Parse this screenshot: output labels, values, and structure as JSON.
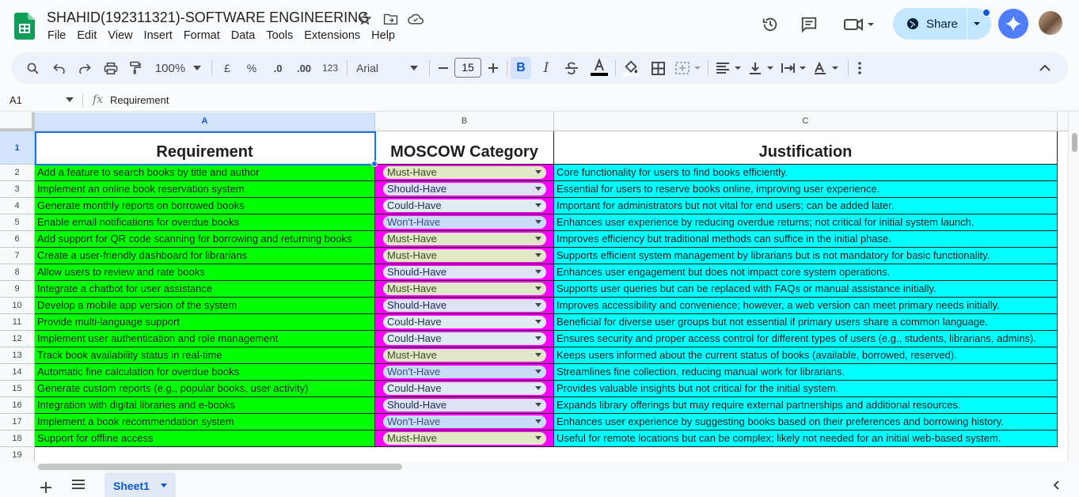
{
  "app": {
    "title": "SHAHID(192311321)-SOFTWARE ENGINEERING",
    "menu": [
      "File",
      "Edit",
      "View",
      "Insert",
      "Format",
      "Data",
      "Tools",
      "Extensions",
      "Help"
    ],
    "share_label": "Share"
  },
  "toolbar": {
    "zoom": "100%",
    "currency": "£",
    "percent": "%",
    "dec_decrease": ".0",
    "dec_increase": ".00",
    "number_format": "123",
    "font": "Arial",
    "font_size": "15"
  },
  "formula_bar": {
    "name_box": "A1",
    "fx": "fx",
    "content": "Requirement"
  },
  "columns": [
    "A",
    "B",
    "C"
  ],
  "row_numbers": [
    "1",
    "2",
    "3",
    "4",
    "5",
    "6",
    "7",
    "8",
    "9",
    "10",
    "11",
    "12",
    "13",
    "14",
    "15",
    "16",
    "17",
    "18",
    "19"
  ],
  "headers": {
    "a": "Requirement",
    "b": "MOSCOW Category",
    "c": "Justification"
  },
  "rows": [
    {
      "req": "Add a feature to search books by title and author",
      "cat": "Must-Have",
      "just": "Core functionality for users to find books efficiently."
    },
    {
      "req": "Implement an online book reservation system",
      "cat": "Should-Have",
      "just": "Essential for users to reserve books online, improving user experience."
    },
    {
      "req": "Generate monthly reports on borrowed books",
      "cat": "Could-Have",
      "just": "Important for administrators but not vital for end users; can be added later."
    },
    {
      "req": "Enable email notifications for overdue books",
      "cat": "Won't-Have",
      "just": "Enhances user experience by reducing overdue returns; not critical for initial system launch."
    },
    {
      "req": "Add support for QR code scanning for borrowing and returning books",
      "cat": "Must-Have",
      "just": "Improves efficiency but traditional methods can suffice in the initial phase."
    },
    {
      "req": "Create a user-friendly dashboard for librarians",
      "cat": "Must-Have",
      "just": "Supports efficient system management by librarians but is not mandatory for basic functionality."
    },
    {
      "req": "Allow users to review and rate books",
      "cat": "Should-Have",
      "just": "Enhances user engagement but does not impact core system operations."
    },
    {
      "req": "Integrate a chatbot for user assistance",
      "cat": "Must-Have",
      "just": "Supports user queries but can be replaced with FAQs or manual assistance initially."
    },
    {
      "req": "Develop a mobile app version of the system",
      "cat": "Should-Have",
      "just": "Improves accessibility and convenience; however, a web version can meet primary needs initially."
    },
    {
      "req": "Provide multi-language support",
      "cat": "Could-Have",
      "just": "Beneficial for diverse user groups but not essential if primary users share a common language."
    },
    {
      "req": "Implement user authentication and role management",
      "cat": "Could-Have",
      "just": "Ensures security and proper access control for different types of users (e.g., students, librarians, admins)."
    },
    {
      "req": "Track book availability status in real-time",
      "cat": "Must-Have",
      "just": "Keeps users informed about the current status of books (available, borrowed, reserved)."
    },
    {
      "req": "Automatic fine calculation for overdue books",
      "cat": "Won't-Have",
      "just": "Streamlines fine collection, reducing manual work for librarians."
    },
    {
      "req": "Generate custom reports (e.g., popular books, user activity)",
      "cat": "Could-Have",
      "just": "Provides valuable insights but not critical for the initial system."
    },
    {
      "req": "Integration with digital libraries and e-books",
      "cat": "Should-Have",
      "just": "Expands library offerings but may require external partnerships and additional resources."
    },
    {
      "req": "Implement a book recommendation system",
      "cat": "Won't-Have",
      "just": "Enhances user experience by suggesting books based on their preferences and borrowing history."
    },
    {
      "req": "Support for offline access",
      "cat": "Must-Have",
      "just": "Useful for remote locations but can be complex; likely not needed for an initial web-based system."
    }
  ],
  "chip_colors": {
    "Must-Have": "#e0e8c8",
    "Should-Have": "#dde3f5",
    "Could-Have": "#e0eaf2",
    "Won't-Have": "#c9dcf7"
  },
  "chip_text_colors": {
    "Must-Have": "#3c4a22",
    "Should-Have": "#1f2a5a",
    "Could-Have": "#1f3545",
    "Won't-Have": "#3a4f7a"
  },
  "sheet": {
    "active_tab": "Sheet1"
  }
}
